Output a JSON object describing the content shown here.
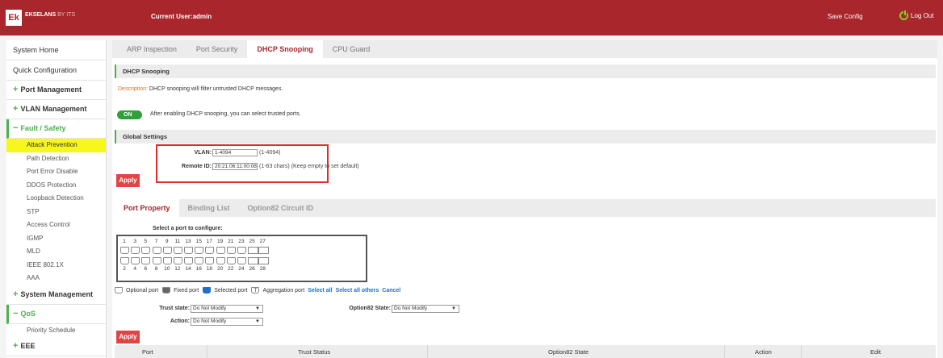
{
  "header": {
    "logo": "Ek",
    "brand": "EKSELANS",
    "brand_sub": "BY ITS",
    "current_user": "Current User:admin",
    "save_config": "Save Config",
    "logout": "Log Out"
  },
  "sidebar": {
    "system_home": "System Home",
    "quick_config": "Quick Configuration",
    "port_mgmt": "Port Management",
    "vlan_mgmt": "VLAN Management",
    "fault_safety": "Fault / Safety",
    "fault_items": [
      "Attack Prevention",
      "Path Detection",
      "Port Error Disable",
      "DDOS Protection",
      "Loopback Detection",
      "STP",
      "Access Control",
      "IGMP",
      "MLD",
      "IEEE 802.1X",
      "AAA"
    ],
    "system_mgmt": "System Management",
    "qos": "QoS",
    "qos_items": [
      "Priority Schedule"
    ],
    "eee": "EEE",
    "plus": "+",
    "minus": "−"
  },
  "tabs": [
    "ARP Inspection",
    "Port Security",
    "DHCP Snooping",
    "CPU Guard"
  ],
  "dhcp": {
    "section_title": "DHCP Snooping",
    "desc_label": "Description:",
    "desc_text": "DHCP snooping will filter untrusted DHCP messages.",
    "toggle": "ON",
    "toggle_note": "After enabling DHCP snooping, you can select trusted ports."
  },
  "global": {
    "section_title": "Global Settings",
    "vlan_label": "VLAN:",
    "vlan_value": "1-4094",
    "vlan_hint": "(1-4094)",
    "remote_label": "Remote ID:",
    "remote_value": "20:21:06:11:00:08",
    "remote_hint": "(1-63 chars) (Keep empty to set default)",
    "apply": "Apply"
  },
  "subtabs": [
    "Port Property",
    "Binding List",
    "Option82 Circuit ID"
  ],
  "ports": {
    "select_label": "Select a port to configure:",
    "top_numbers": [
      "1",
      "3",
      "5",
      "7",
      "9",
      "11",
      "13",
      "15",
      "17",
      "19",
      "21",
      "23",
      "25",
      "27"
    ],
    "bottom_numbers": [
      "2",
      "4",
      "6",
      "8",
      "10",
      "12",
      "14",
      "16",
      "18",
      "20",
      "22",
      "24",
      "26",
      "28"
    ]
  },
  "legend": {
    "optional": "Optional port",
    "fixed": "Fixed port",
    "selected": "Selected port",
    "agg_symbol": "T",
    "aggregation": "Aggregation port",
    "select_all": "Select all",
    "select_all_others": "Select all others",
    "cancel": "Cancel"
  },
  "form": {
    "trust_label": "Trust state:",
    "trust_value": "Do Not Modify",
    "option82_label": "Option82 State:",
    "option82_value": "Do Not Modify",
    "action_label": "Action:",
    "action_value": "Do Not Modify",
    "dropdown_arrow": "▼",
    "apply": "Apply"
  },
  "table": {
    "headers": [
      "Port",
      "Trust Status",
      "Option82 State",
      "Action",
      "Edit"
    ]
  },
  "colors": {
    "brand": "#a8262c",
    "accent": "#4caf50",
    "active_highlight": "#f7f71c",
    "apply": "#e04545",
    "highlight_box": "#e52a2a"
  }
}
